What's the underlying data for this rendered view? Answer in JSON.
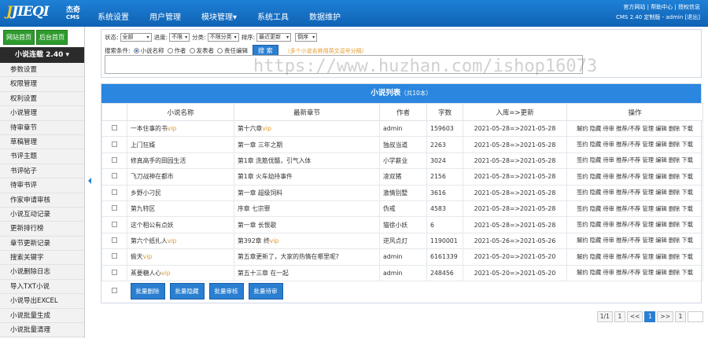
{
  "header": {
    "logo_text": "JIEQI",
    "logo_cn": "杰奇",
    "logo_cms": "CMS",
    "nav": [
      {
        "label": "系统设置"
      },
      {
        "label": "用户管理"
      },
      {
        "label": "模块管理▾"
      },
      {
        "label": "系统工具"
      },
      {
        "label": "数据维护"
      }
    ],
    "links": {
      "site": "官方网站",
      "help": "帮助中心",
      "auth": "授权信息"
    },
    "version_line": "CMS 2.40 定制版 - admin [退出]"
  },
  "sidebar": {
    "btn_home": "网站首页",
    "btn_admin": "后台首页",
    "section_title": "小说连载 2.40 ▾",
    "items": [
      "参数设置",
      "权限管理",
      "权利设置",
      "小说管理",
      "待审章节",
      "草稿管理",
      "书评主题",
      "书评帖子",
      "待审书评",
      "作家申请审核",
      "小说互动记录",
      "更新排行榜",
      "章节更新记录",
      "搜索关键字",
      "小说删除日志",
      "导入TXT小说",
      "小说导出EXCEL",
      "小说批量生成",
      "小说批量清理"
    ]
  },
  "filter": {
    "status_label": "状态:",
    "status_value": "全部",
    "progress_label": "进度:",
    "progress_value": "不限",
    "category_label": "分类:",
    "category_value": "不限分类",
    "sort_label": "排序:",
    "sort_value": "最近更新",
    "order_value": "倒序",
    "search_label": "搜索条件:",
    "radio_novel": "小说名称",
    "radio_author": "作者",
    "radio_poster": "发表者",
    "radio_editor": "责任编辑",
    "search_button": "搜 索",
    "hint": "（多个小说名称用英文逗号分隔）"
  },
  "watermark": "https://www.huzhan.com/ishop16073",
  "table": {
    "title": "小说列表",
    "count": "（共10本）",
    "headers": [
      "小说名称",
      "最新章节",
      "作者",
      "字数",
      "入库=>更新",
      "操作"
    ],
    "ops": "解约 隐藏 待审 推荐/不荐 管理 编辑 删除 下载",
    "ops_first": "签约 隐藏 待审 推荐/不荐 管理 编辑 删除 下载",
    "rows": [
      {
        "name": "一本住事的书",
        "name_vip": "vip",
        "chapter": "第十六章",
        "chapter_vip": "vip",
        "author": "admin",
        "words": "159603",
        "dates": "2021-05-28=>2021-05-28",
        "ops": "解约 隐藏 待审 推荐/不荐 管理 编辑 删除 下载"
      },
      {
        "name": "上门狂婿",
        "name_vip": "",
        "chapter": "第一章 三年之期",
        "chapter_vip": "",
        "author": "独叔当道",
        "words": "2263",
        "dates": "2021-05-28=>2021-05-28",
        "ops": "签约 隐藏 待审 推荐/不荐 管理 编辑 删除 下载"
      },
      {
        "name": "修真高手的田园生活",
        "name_vip": "",
        "chapter": "第1章 洗筋伐髓，引气入体",
        "chapter_vip": "",
        "author": "小学薪业",
        "words": "3024",
        "dates": "2021-05-28=>2021-05-28",
        "ops": "签约 隐藏 待审 推荐/不荐 管理 编辑 删除 下载"
      },
      {
        "name": "飞刀战神在都市",
        "name_vip": "",
        "chapter": "第1章 火车劫持事件",
        "chapter_vip": "",
        "author": "凌双猪",
        "words": "2156",
        "dates": "2021-05-28=>2021-05-28",
        "ops": "签约 隐藏 待审 推荐/不荐 管理 编辑 删除 下载"
      },
      {
        "name": "乡野小刁民",
        "name_vip": "",
        "chapter": "第一章 超级饲料",
        "chapter_vip": "",
        "author": "激情别墅",
        "words": "3616",
        "dates": "2021-05-28=>2021-05-28",
        "ops": "签约 隐藏 待审 推荐/不荐 管理 编辑 删除 下载"
      },
      {
        "name": "第九特区",
        "name_vip": "",
        "chapter": "序章 七宗罪",
        "chapter_vip": "",
        "author": "伪戒",
        "words": "4583",
        "dates": "2021-05-28=>2021-05-28",
        "ops": "签约 隐藏 待审 推荐/不荐 管理 编辑 删除 下载"
      },
      {
        "name": "这个相公有点妖",
        "name_vip": "",
        "chapter": "第一章 长恨歌",
        "chapter_vip": "",
        "author": "猫徐小妖",
        "words": "6",
        "dates": "2021-05-28=>2021-05-28",
        "ops": "签约 隐藏 待审 推荐/不荐 管理 编辑 删除 下载"
      },
      {
        "name": "第六个纸扎人",
        "name_vip": "vip",
        "chapter": "第392章 终",
        "chapter_vip": "vip",
        "author": "逆风点灯",
        "words": "1190001",
        "dates": "2021-05-26=>2021-05-26",
        "ops": "解约 隐藏 待审 推荐/不荐 管理 编辑 删除 下载"
      },
      {
        "name": "偷天",
        "name_vip": "vip",
        "chapter": "第五章更新了，大家的热情在哪里呢?",
        "chapter_vip": "",
        "author": "admin",
        "words": "6161339",
        "dates": "2021-05-20=>2021-05-20",
        "ops": "解约 隐藏 待审 推荐/不荐 管理 编辑 删除 下载"
      },
      {
        "name": "蒸要糖人心",
        "name_vip": "vip",
        "chapter": "第五十三章 在一起",
        "chapter_vip": "",
        "author": "admin",
        "words": "248456",
        "dates": "2021-05-20=>2021-05-20",
        "ops": "解约 隐藏 待审 推荐/不荐 管理 编辑 删除 下载"
      }
    ],
    "batch": [
      "批量删除",
      "批量隐藏",
      "批量审核",
      "批量待审"
    ]
  },
  "pager": {
    "info": "1/1",
    "first": "1",
    "prev": "<<",
    "current": "1",
    "next": ">>",
    "last": "1"
  }
}
